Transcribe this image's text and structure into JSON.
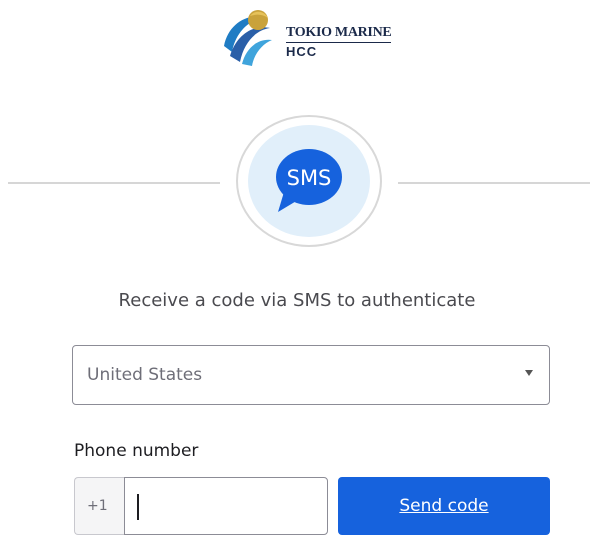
{
  "brand": {
    "name_line1": "TOKIO MARINE",
    "name_line2": "HCC"
  },
  "factor_icon": {
    "label": "SMS",
    "icon": "sms-bubble-icon",
    "bubble_color": "#1662dd",
    "circle_bg": "#e1effa"
  },
  "subtitle": "Receive a code via SMS to authenticate",
  "country_select": {
    "value": "United States"
  },
  "phone": {
    "label": "Phone number",
    "prefix": "+1",
    "value": ""
  },
  "send_button": {
    "label": "Send code",
    "color": "#1662dd"
  }
}
